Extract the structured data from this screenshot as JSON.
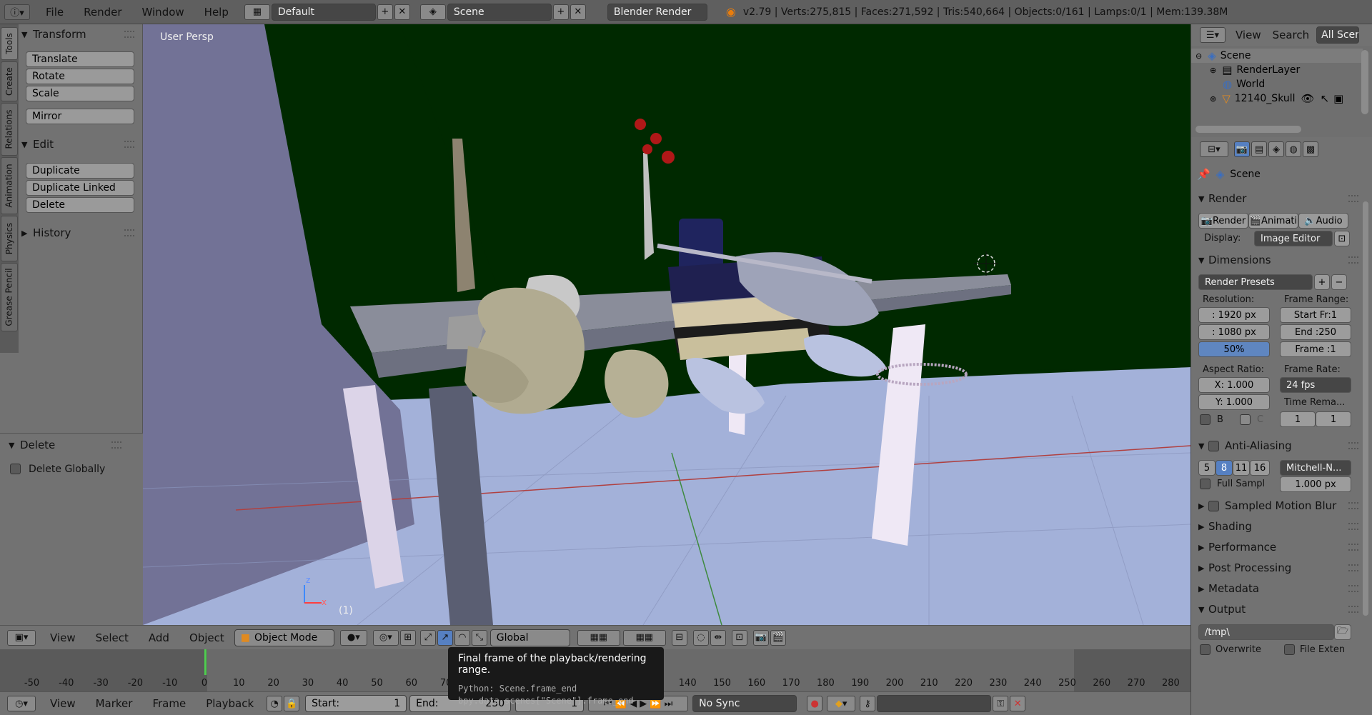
{
  "topbar": {
    "menus": [
      "File",
      "Render",
      "Window",
      "Help"
    ],
    "layout": "Default",
    "scene": "Scene",
    "engine": "Blender Render",
    "stats": "v2.79 | Verts:275,815 | Faces:271,592 | Tris:540,664 | Objects:0/161 | Lamps:0/1 | Mem:139.38M"
  },
  "toolshelf": {
    "tabs": [
      "Tools",
      "Create",
      "Relations",
      "Animation",
      "Physics",
      "Grease Pencil"
    ],
    "transform": {
      "title": "Transform",
      "buttons": [
        "Translate",
        "Rotate",
        "Scale",
        "Mirror"
      ]
    },
    "edit": {
      "title": "Edit",
      "buttons": [
        "Duplicate",
        "Duplicate Linked",
        "Delete"
      ]
    },
    "history": {
      "title": "History"
    },
    "operator": {
      "title": "Delete",
      "option": "Delete Globally"
    }
  },
  "viewport": {
    "label": "User Persp",
    "frame": "(1)",
    "axis_x": "x",
    "axis_z": "z"
  },
  "view3d_header": {
    "menus": [
      "View",
      "Select",
      "Add",
      "Object"
    ],
    "mode": "Object Mode",
    "orientation": "Global"
  },
  "timeline": {
    "ticks": [
      "-50",
      "-40",
      "-30",
      "-20",
      "-10",
      "0",
      "10",
      "20",
      "30",
      "40",
      "50",
      "60",
      "70",
      "140",
      "150",
      "160",
      "170",
      "180",
      "190",
      "200",
      "210",
      "220",
      "230",
      "240",
      "250",
      "260",
      "270",
      "280"
    ],
    "menus": [
      "View",
      "Marker",
      "Frame",
      "Playback"
    ],
    "start_label": "Start:",
    "start_value": "1",
    "end_label": "End:",
    "end_value": "250",
    "current": "1",
    "sync": "No Sync"
  },
  "tooltip": {
    "title": "Final frame of the playback/rendering range.",
    "python": "Python: Scene.frame_end",
    "path": "bpy.data.scenes[\"Scene\"].frame_end"
  },
  "outliner": {
    "menus": [
      "View",
      "Search"
    ],
    "scope": "All Scenes",
    "items": [
      "Scene",
      "RenderLayer",
      "World",
      "12140_Skull"
    ]
  },
  "properties": {
    "context": "Scene",
    "render": {
      "title": "Render",
      "buttons": [
        "Render",
        "Animati",
        "Audio"
      ],
      "display_label": "Display:",
      "display_value": "Image Editor"
    },
    "dimensions": {
      "title": "Dimensions",
      "presets": "Render Presets",
      "resolution_label": "Resolution:",
      "res_x": ": 1920 px",
      "res_y": ": 1080 px",
      "res_pct": "50%",
      "frame_range_label": "Frame Range:",
      "start": "Start Fr:1",
      "end": "End :250",
      "frame": "Frame :1",
      "aspect_label": "Aspect Ratio:",
      "aspect_x": "X:  1.000",
      "aspect_y": "Y:  1.000",
      "framerate_label": "Frame Rate:",
      "fps": "24 fps",
      "time_remap_label": "Time Rema...",
      "remap_old": "1",
      "remap_new": "1",
      "border_b": "B",
      "border_c": "C"
    },
    "anti_aliasing": {
      "title": "Anti-Aliasing",
      "samples": [
        "5",
        "8",
        "11",
        "16"
      ],
      "filter": "Mitchell-N...",
      "full_sample": "Full Sampl",
      "size": "1.000 px"
    },
    "sections": [
      "Sampled Motion Blur",
      "Shading",
      "Performance",
      "Post Processing",
      "Metadata",
      "Output"
    ],
    "output": {
      "path": "/tmp\\",
      "overwrite": "Overwrite",
      "file_ext": "File Exten"
    }
  },
  "colors": {
    "viewport_bg": "#002900",
    "floor": "#a3b1d9",
    "wall": "#727296",
    "table": "#8a8d9a",
    "accent": "#5680c2",
    "tooltip_bg": "#191919"
  }
}
